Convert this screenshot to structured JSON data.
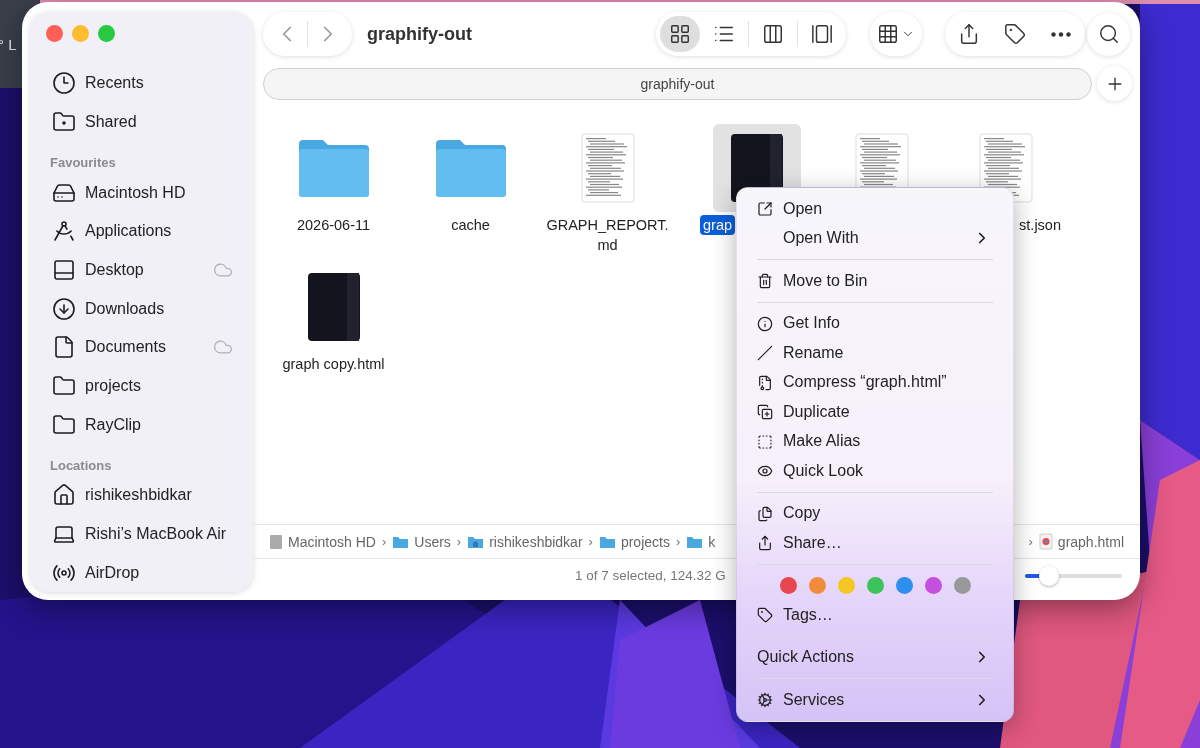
{
  "desktop_widget": {
    "text": "° L"
  },
  "sidebar": {
    "sections": [
      {
        "items": [
          {
            "label": "Recents",
            "cloud": false
          },
          {
            "label": "Shared",
            "cloud": false
          }
        ]
      },
      {
        "heading": "Favourites",
        "items": [
          {
            "label": "Macintosh HD",
            "cloud": false
          },
          {
            "label": "Applications",
            "cloud": false
          },
          {
            "label": "Desktop",
            "cloud": true
          },
          {
            "label": "Downloads",
            "cloud": false
          },
          {
            "label": "Documents",
            "cloud": true
          },
          {
            "label": "projects",
            "cloud": false
          },
          {
            "label": "RayClip",
            "cloud": false
          }
        ]
      },
      {
        "heading": "Locations",
        "items": [
          {
            "label": "rishikeshbidkar",
            "cloud": false
          },
          {
            "label": "Rishi’s MacBook Air",
            "cloud": false
          },
          {
            "label": "AirDrop",
            "cloud": false
          }
        ]
      }
    ]
  },
  "toolbar": {
    "title": "graphify-out",
    "view_buttons": [
      {
        "selected": true
      },
      {
        "selected": false
      },
      {
        "selected": false
      },
      {
        "selected": false
      }
    ]
  },
  "path_field": {
    "value": "graphify-out"
  },
  "files": [
    {
      "kind": "folder",
      "label": "2026-06-11",
      "selected": false
    },
    {
      "kind": "folder",
      "label": "cache",
      "selected": false
    },
    {
      "kind": "text",
      "label": "GRAPH_REPORT.\nmd",
      "selected": false
    },
    {
      "kind": "dark",
      "label": "grap",
      "selected": true
    },
    {
      "kind": "text",
      "selected": false
    },
    {
      "kind": "text",
      "label": "st.json",
      "selected": false
    },
    {
      "kind": "dark",
      "label": "graph copy.html",
      "selected": false
    }
  ],
  "path_bar": {
    "left": [
      {
        "kind": "disk",
        "label": "Macintosh HD"
      },
      {
        "kind": "folder",
        "label": "Users",
        "chevron": "›"
      },
      {
        "kind": "home",
        "label": "rishikeshbidkar",
        "chevron": "›"
      },
      {
        "kind": "folder",
        "label": "projects",
        "chevron": "›"
      },
      {
        "kind": "folder",
        "label": "k",
        "chevron": "›"
      }
    ],
    "right": [
      {
        "kind": "file",
        "label": "graph.html",
        "chevron": "›"
      }
    ]
  },
  "status_bar": {
    "text": "1 of 7 selected, 124.32 G",
    "zoom": {
      "level": 0.25
    }
  },
  "context_menu": {
    "items": [
      {
        "kind": "action",
        "label": "Open",
        "submenu": false
      },
      {
        "kind": "action",
        "label": "Open With",
        "submenu": true
      },
      {
        "kind": "separator"
      },
      {
        "kind": "action",
        "label": "Move to Bin",
        "submenu": false
      },
      {
        "kind": "separator"
      },
      {
        "kind": "action",
        "label": "Get Info",
        "submenu": false
      },
      {
        "kind": "action",
        "label": "Rename",
        "submenu": false
      },
      {
        "kind": "action",
        "label": "Compress “graph.html”",
        "submenu": false
      },
      {
        "kind": "action",
        "label": "Duplicate",
        "submenu": false
      },
      {
        "kind": "action",
        "label": "Make Alias",
        "submenu": false
      },
      {
        "kind": "action",
        "label": "Quick Look",
        "submenu": false
      },
      {
        "kind": "separator"
      },
      {
        "kind": "action",
        "label": "Copy",
        "submenu": false
      },
      {
        "kind": "action",
        "label": "Share…",
        "submenu": false
      },
      {
        "kind": "separator"
      },
      {
        "kind": "tags",
        "tags": [
          {
            "color": "#e8474f"
          },
          {
            "color": "#f28c3c"
          },
          {
            "color": "#f5c724"
          },
          {
            "color": "#3ec25a"
          },
          {
            "color": "#2d8ff0"
          },
          {
            "color": "#c450e0"
          },
          {
            "color": "#999999"
          }
        ]
      },
      {
        "kind": "action",
        "label": "Tags…",
        "submenu": false
      },
      {
        "kind": "separator"
      },
      {
        "kind": "plain",
        "label": "Quick Actions",
        "submenu": true
      },
      {
        "kind": "separator"
      },
      {
        "kind": "action",
        "label": "Services",
        "submenu": true
      }
    ]
  }
}
